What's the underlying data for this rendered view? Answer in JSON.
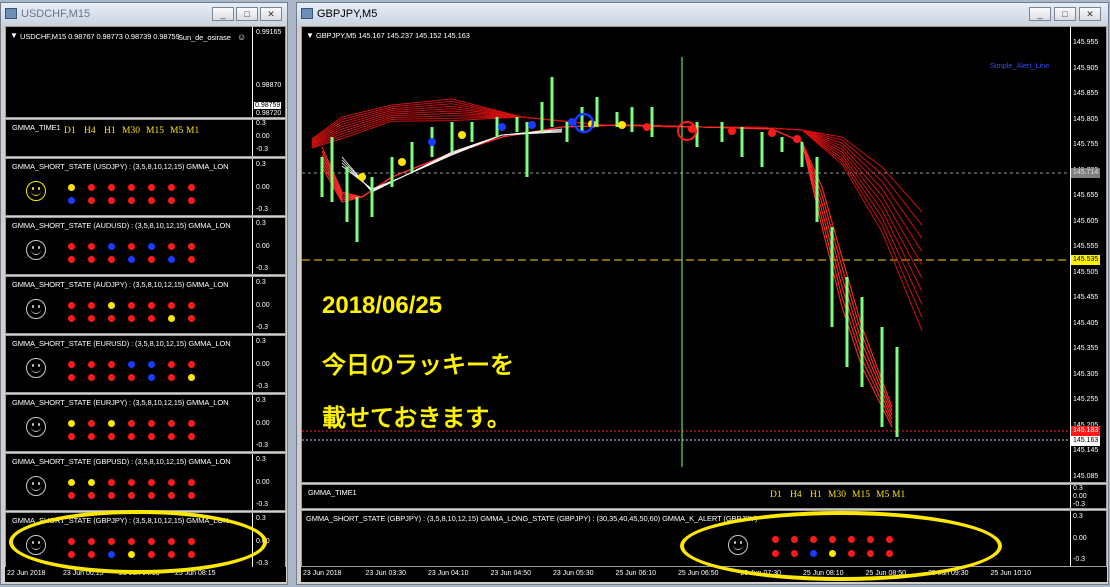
{
  "left_window": {
    "title": "USDCHF,M15",
    "header": "USDCHF,M15  0.98767 0.98773 0.98739 0.98759",
    "overlay": "Sun_de_osirase",
    "scale": [
      "0.99165",
      "0.98870",
      "0.98759",
      "0.98720"
    ],
    "time_title": "GMMA_TIME1",
    "tf": [
      "D1",
      "H4",
      "H1",
      "M30",
      "M15",
      "M5",
      "M1"
    ],
    "x_axis": [
      "22 Jun 2018",
      "23 Jun 00:15",
      "23 Jun 04:15",
      "25 Jun 08:15"
    ]
  },
  "right_window": {
    "title": "GBPJPY,M5",
    "header": "GBPJPY,M5  145.167 145.237 145.152 145.163",
    "alert_label": "Simple_Alert_Line",
    "price_scale": [
      "145.955",
      "145.905",
      "145.855",
      "145.805",
      "145.755",
      "145.705",
      "145.655",
      "145.605",
      "145.555",
      "145.505",
      "145.455",
      "145.405",
      "145.355",
      "145.305",
      "145.255",
      "145.205",
      "145.145",
      "145.085"
    ],
    "price_boxes": {
      "dashed_grey": "145.714",
      "yellow_line": "145.535",
      "red": "145.183",
      "current": "145.163"
    },
    "time_title": "GMMA_TIME1",
    "tf": [
      "D1",
      "H4",
      "H1",
      "M30",
      "M15",
      "M5",
      "M1"
    ],
    "state_title": "GMMA_SHORT_STATE (GBPJPY) : (3,5,8,10,12,15)  GMMA_LONG_STATE (GBPJPY) : (30,35,40,45,50,60)  GMMA_K_ALERT (GBPJPY)",
    "x_axis": [
      "23 Jun 2018",
      "23 Jun 03:30",
      "23 Jun 04:10",
      "23 Jun 04:50",
      "23 Jun 05:30",
      "25 Jun 06:10",
      "25 Jun 06:50",
      "25 Jun 07:30",
      "25 Jun 08:10",
      "25 Jun 08:50",
      "25 Jun 09:30",
      "25 Jun 10:10"
    ],
    "sub_scale": [
      "0.3",
      "0.00",
      "-0.3"
    ],
    "annotation": [
      "2018/06/25",
      "今日のラッキーを",
      "載せておきます。"
    ]
  },
  "state_panels": [
    {
      "title": "GMMA_SHORT_STATE (USDJPY) : (3,5,8,10,12,15)  GMMA_LON",
      "happy": true,
      "rows": [
        [
          "yellow",
          "red",
          "red",
          "red",
          "red",
          "red",
          "red"
        ],
        [
          "blue",
          "red",
          "red",
          "red",
          "red",
          "red",
          "red"
        ]
      ]
    },
    {
      "title": "GMMA_SHORT_STATE (AUDUSD) : (3,5,8,10,12,15)  GMMA_LON",
      "happy": false,
      "rows": [
        [
          "red",
          "red",
          "blue",
          "red",
          "blue",
          "red",
          "red"
        ],
        [
          "red",
          "red",
          "red",
          "blue",
          "red",
          "blue",
          "red"
        ]
      ]
    },
    {
      "title": "GMMA_SHORT_STATE (AUDJPY) : (3,5,8,10,12,15)  GMMA_LON",
      "happy": false,
      "rows": [
        [
          "red",
          "red",
          "yellow",
          "red",
          "red",
          "red",
          "red"
        ],
        [
          "red",
          "red",
          "red",
          "red",
          "red",
          "yellow",
          "red"
        ]
      ]
    },
    {
      "title": "GMMA_SHORT_STATE (EURUSD) : (3,5,8,10,12,15)  GMMA_LON",
      "happy": false,
      "rows": [
        [
          "red",
          "red",
          "red",
          "blue",
          "blue",
          "red",
          "red"
        ],
        [
          "red",
          "red",
          "red",
          "red",
          "blue",
          "red",
          "yellow"
        ]
      ]
    },
    {
      "title": "GMMA_SHORT_STATE (EURJPY) : (3,5,8,10,12,15)  GMMA_LON",
      "happy": false,
      "rows": [
        [
          "yellow",
          "red",
          "yellow",
          "red",
          "red",
          "red",
          "red"
        ],
        [
          "red",
          "red",
          "red",
          "red",
          "red",
          "red",
          "red"
        ]
      ]
    },
    {
      "title": "GMMA_SHORT_STATE (GBPUSD) : (3,5,8,10,12,15)  GMMA_LON",
      "happy": false,
      "rows": [
        [
          "yellow",
          "yellow",
          "red",
          "red",
          "red",
          "red",
          "red"
        ],
        [
          "red",
          "red",
          "red",
          "red",
          "red",
          "red",
          "red"
        ]
      ]
    },
    {
      "title": "GMMA_SHORT_STATE (GBPJPY) : (3,5,8,10,12,15)  GMMA_LON",
      "happy": false,
      "rows": [
        [
          "red",
          "red",
          "red",
          "red",
          "red",
          "red",
          "red"
        ],
        [
          "red",
          "red",
          "blue",
          "yellow",
          "red",
          "red",
          "red"
        ]
      ]
    }
  ],
  "right_state_rows": [
    [
      "red",
      "red",
      "red",
      "red",
      "red",
      "red",
      "red"
    ],
    [
      "red",
      "red",
      "blue",
      "yellow",
      "red",
      "red",
      "red"
    ]
  ],
  "colors": {
    "red": "#ff1a1a",
    "blue": "#1a3cff",
    "yellow": "#ffe600"
  }
}
